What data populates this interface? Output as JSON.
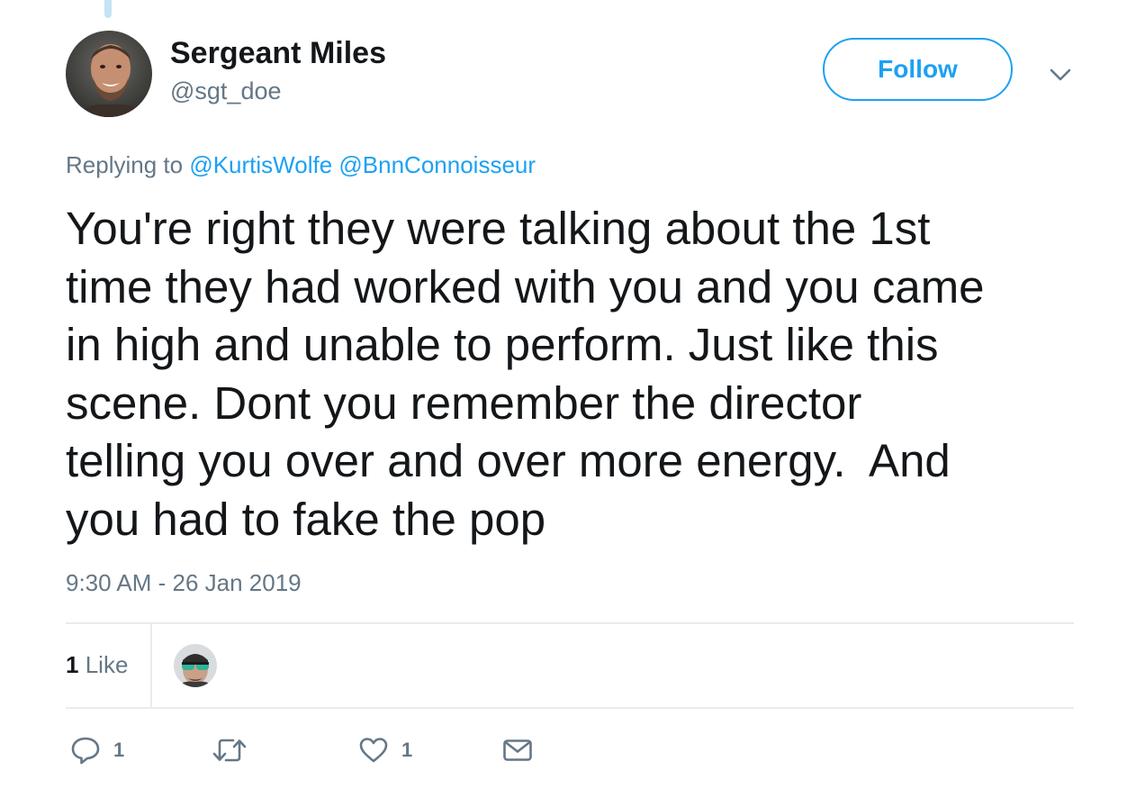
{
  "tweet": {
    "author": {
      "display_name": "Sergeant Miles",
      "handle": "@sgt_doe"
    },
    "follow_label": "Follow",
    "replying_prefix": "Replying to",
    "replying_to": [
      "@KurtisWolfe",
      "@BnnConnoisseur"
    ],
    "text": "You're right they were talking about the 1st time they had worked with you and you came in high and unable to perform. Just like this scene. Dont you remember the director telling you over and over more energy.  And you had to fake the pop",
    "text_lines": [
      "You're right they were talking about the 1st",
      "time they had worked with you and you came",
      "in high and unable to perform. Just like this",
      "scene. Dont you remember the director",
      "telling you over and over more energy.  And",
      "you had to fake the pop"
    ],
    "timestamp": "9:30 AM - 26 Jan 2019",
    "stats": {
      "like_count": "1",
      "like_label": "Like"
    },
    "actions": {
      "reply_count": "1",
      "retweet_count": "",
      "like_count": "1"
    }
  },
  "icons": {
    "more": "chevron-down-icon",
    "reply": "reply-icon",
    "retweet": "retweet-icon",
    "like": "heart-icon",
    "dm": "envelope-icon"
  },
  "colors": {
    "accent": "#1da1f2",
    "text": "#14171a",
    "secondary_text": "#657786",
    "divider": "#e6ecf0",
    "thread_line": "#c4e3f6"
  }
}
